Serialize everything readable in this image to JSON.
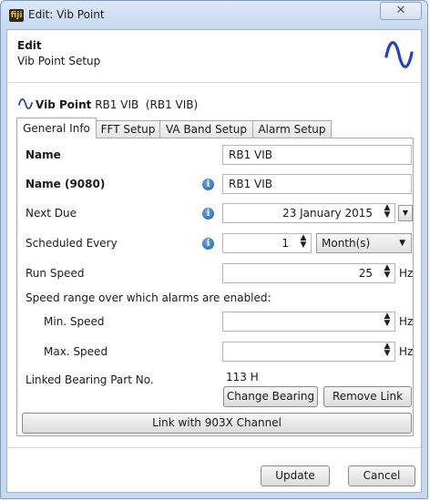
{
  "window": {
    "title": "Edit: Vib Point",
    "app_icon_text": "fiji",
    "close_glyph": "✕"
  },
  "header": {
    "title": "Edit",
    "subtitle": "Vib Point Setup",
    "icon": "sine-wave-icon"
  },
  "vib_point": {
    "label": "Vib Point",
    "value": "RB1 VIB  (RB1 VIB)"
  },
  "tabs": [
    {
      "label": "General Info",
      "active": true
    },
    {
      "label": "FFT Setup",
      "active": false
    },
    {
      "label": "VA Band Setup",
      "active": false
    },
    {
      "label": "Alarm Setup",
      "active": false
    }
  ],
  "form": {
    "name": {
      "label": "Name",
      "value": "RB1 VIB"
    },
    "name9080": {
      "label": "Name (9080)",
      "value": "RB1 VIB"
    },
    "next_due": {
      "label": "Next Due",
      "value": "23 January 2015"
    },
    "scheduled": {
      "label": "Scheduled Every",
      "value": "1",
      "unit_option": "Month(s)"
    },
    "run_speed": {
      "label": "Run Speed",
      "value": "25",
      "unit": "Hz"
    },
    "speed_range_caption": "Speed range over which alarms are enabled:",
    "min_speed": {
      "label": "Min. Speed",
      "value": "",
      "unit": "Hz"
    },
    "max_speed": {
      "label": "Max. Speed",
      "value": "",
      "unit": "Hz"
    },
    "bearing": {
      "label": "Linked Bearing Part No.",
      "value": "113 H",
      "change_button": "Change Bearing",
      "remove_button": "Remove Link"
    },
    "link_button": "Link with 903X Channel"
  },
  "footer": {
    "update_button": "Update",
    "cancel_button": "Cancel"
  },
  "colors": {
    "wave": "#1f3fcf",
    "info": "#1d5fb8",
    "frame": "#c6d9ef"
  }
}
